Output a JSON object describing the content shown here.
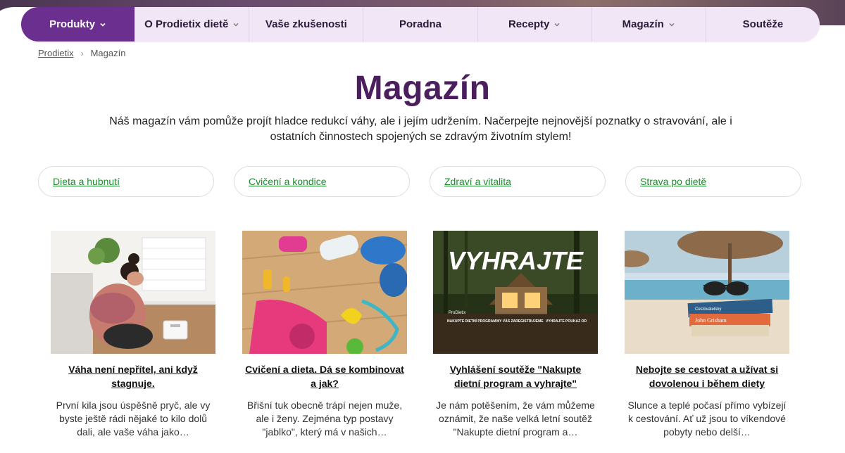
{
  "nav": {
    "items": [
      {
        "label": "Produkty",
        "has_dropdown": true,
        "active": true
      },
      {
        "label": "O Prodietix dietě",
        "has_dropdown": true,
        "active": false
      },
      {
        "label": "Vaše zkušenosti",
        "has_dropdown": false,
        "active": false
      },
      {
        "label": "Poradna",
        "has_dropdown": false,
        "active": false
      },
      {
        "label": "Recepty",
        "has_dropdown": true,
        "active": false
      },
      {
        "label": "Magazín",
        "has_dropdown": true,
        "active": false
      },
      {
        "label": "Soutěže",
        "has_dropdown": false,
        "active": false
      }
    ]
  },
  "breadcrumb": {
    "home": "Prodietix",
    "separator": "›",
    "current": "Magazín"
  },
  "page": {
    "title": "Magazín",
    "intro": "Náš magazín vám pomůže projít hladce redukcí váhy, ale i jejím udržením. Načerpejte nejnovější poznatky o stravování, ale i ostatních činnostech spojených se zdravým životním stylem!"
  },
  "categories": [
    "Dieta a hubnutí",
    "Cvičení a kondice",
    "Zdraví a vitalita",
    "Strava po dietě"
  ],
  "articles": [
    {
      "title": "Váha není nepřítel, ani když stagnuje.",
      "excerpt": "První kila jsou úspěšně pryč, ale vy byste ještě rádi nějaké to kilo dolů dali, ale vaše váha jako…",
      "image_icon": "woman-with-scale-image"
    },
    {
      "title": "Cvičení a dieta. Dá se kombinovat a jak?",
      "excerpt": "Břišní tuk obecně trápí nejen muže, ale i ženy. Zejména typ postavy \"jablko\", který má v našich…",
      "image_icon": "fitness-equipment-image"
    },
    {
      "title": "Vyhlášení soutěže \"Nakupte dietní program a vyhrajte\"",
      "excerpt": "Je nám potěšením, že vám můžeme oznámit, že naše velká letní soutěž \"Nakupte dietní program a…",
      "image_icon": "contest-cabin-image",
      "image_text": {
        "headline": "VYHRAJTE",
        "brand": "ProDietix",
        "col1": "NAKUPTE DIETNÍ PROGRAM",
        "col2": "MY VÁS ZAREGISTRUJEME",
        "col3": "VYHRAJTE POUKAZ OD"
      }
    },
    {
      "title": "Nebojte se cestovat a užívat si dovolenou i během diety",
      "excerpt": "Slunce a teplé počasí přímo vybízejí k cestování. Ať už jsou to víkendové pobyty nebo delší…",
      "image_icon": "beach-books-image",
      "image_text": {
        "book1": "Cestovatelský",
        "book2": "John Grisham"
      }
    }
  ],
  "colors": {
    "nav_active": "#6b2f8f",
    "nav_bg": "#f0e6f5",
    "title": "#4b1f5e",
    "link_green": "#1e8b2e"
  }
}
